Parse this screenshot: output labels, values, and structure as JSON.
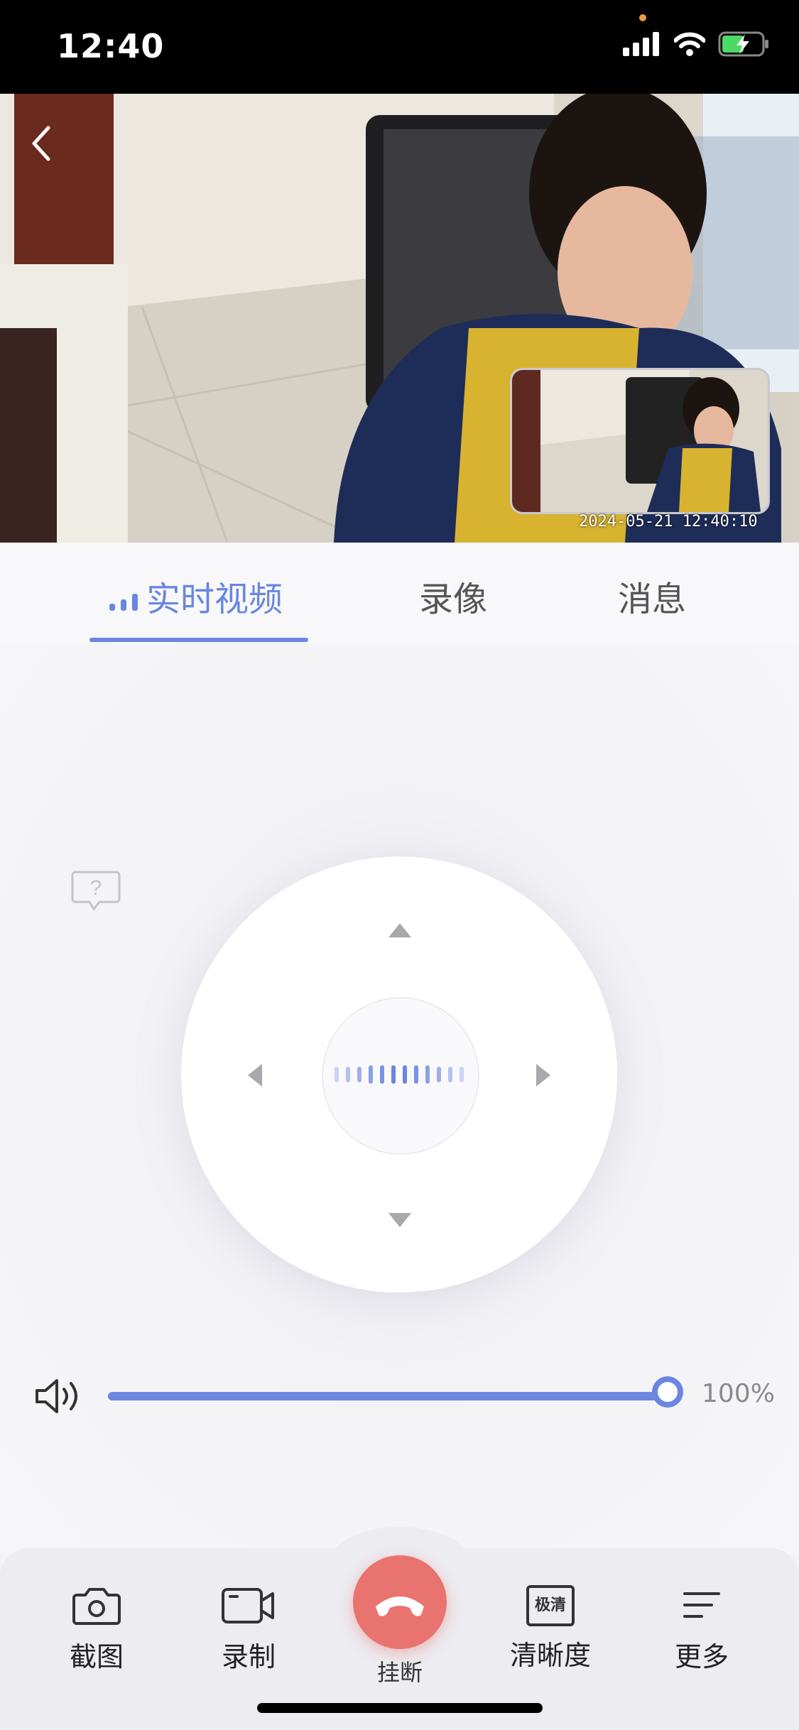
{
  "status_bar": {
    "time": "12:40"
  },
  "video": {
    "timestamp": "2024-05-21 12:40:10"
  },
  "tabs": [
    {
      "label": "实时视频",
      "active": true
    },
    {
      "label": "录像",
      "active": false
    },
    {
      "label": "消息",
      "active": false
    }
  ],
  "volume": {
    "label": "100%",
    "level": 1.0
  },
  "toolbar": {
    "screenshot": "截图",
    "record": "录制",
    "hangup": "挂断",
    "quality_badge": "极清",
    "quality": "清晰度",
    "more": "更多"
  },
  "colors": {
    "accent": "#6a86e0",
    "hangup": "#e9736f"
  }
}
